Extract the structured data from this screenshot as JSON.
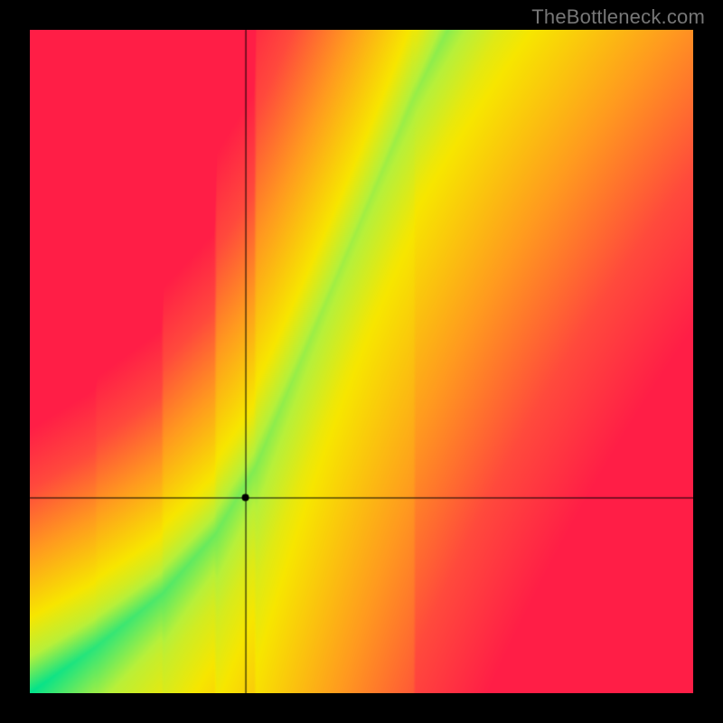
{
  "watermark": "TheBottleneck.com",
  "chart_data": {
    "type": "heatmap",
    "title": "",
    "xlabel": "",
    "ylabel": "",
    "xlim": [
      0,
      1
    ],
    "ylim": [
      0,
      1
    ],
    "grid": false,
    "legend": false,
    "crosshair": {
      "x": 0.325,
      "y": 0.295
    },
    "marker": {
      "x": 0.325,
      "y": 0.295,
      "radius": 4,
      "color": "#000000"
    },
    "ridge": {
      "description": "green optimal band: GPU requirement as a function of CPU (normalized 0..1)",
      "points": [
        {
          "x": 0.0,
          "y": 0.0
        },
        {
          "x": 0.1,
          "y": 0.07
        },
        {
          "x": 0.2,
          "y": 0.15
        },
        {
          "x": 0.28,
          "y": 0.24
        },
        {
          "x": 0.34,
          "y": 0.34
        },
        {
          "x": 0.4,
          "y": 0.48
        },
        {
          "x": 0.46,
          "y": 0.62
        },
        {
          "x": 0.52,
          "y": 0.76
        },
        {
          "x": 0.58,
          "y": 0.9
        },
        {
          "x": 0.63,
          "y": 1.0
        }
      ],
      "band_halfwidth": 0.045
    },
    "color_stops": [
      {
        "t": 0.0,
        "hex": "#00E28C"
      },
      {
        "t": 0.18,
        "hex": "#B7F03A"
      },
      {
        "t": 0.32,
        "hex": "#F7E600"
      },
      {
        "t": 0.55,
        "hex": "#FF9A1F"
      },
      {
        "t": 0.78,
        "hex": "#FF4A3C"
      },
      {
        "t": 1.0,
        "hex": "#FF1E46"
      }
    ],
    "asymmetry": 0.65
  }
}
